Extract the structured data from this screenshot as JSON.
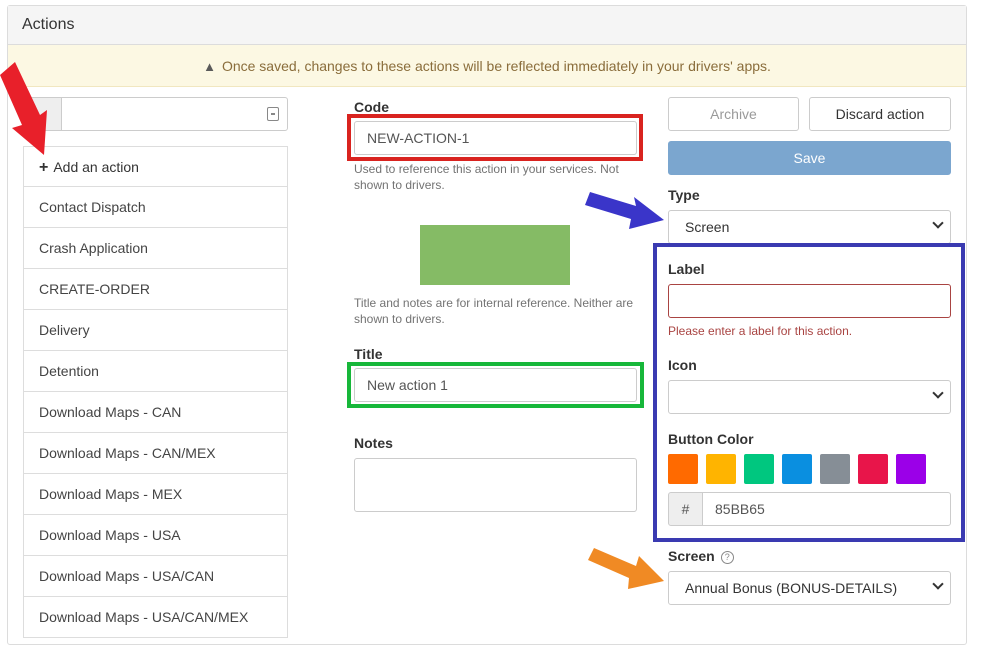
{
  "header": {
    "title": "Actions"
  },
  "warning": {
    "text": "Once saved, changes to these actions will be reflected immediately in your drivers' apps."
  },
  "search": {
    "placeholder": ""
  },
  "action_list": [
    "Add an action",
    "Contact Dispatch",
    "Crash Application",
    "CREATE-ORDER",
    "Delivery",
    "Detention",
    "Download Maps - CAN",
    "Download Maps - CAN/MEX",
    "Download Maps - MEX",
    "Download Maps - USA",
    "Download Maps - USA/CAN",
    "Download Maps - USA/CAN/MEX"
  ],
  "form": {
    "code_label": "Code",
    "code_value": "NEW-ACTION-1",
    "code_help": "Used to reference this action in your services. Not shown to drivers.",
    "preview_color": "#85BB65",
    "internal_help": "Title and notes are for internal reference. Neither are shown to drivers.",
    "title_label": "Title",
    "title_value": "New action 1",
    "notes_label": "Notes",
    "notes_value": ""
  },
  "buttons": {
    "archive": "Archive",
    "discard": "Discard action",
    "save": "Save"
  },
  "settings": {
    "type_label": "Type",
    "type_value": "Screen",
    "label_label": "Label",
    "label_value": "",
    "label_error": "Please enter a label for this action.",
    "icon_label": "Icon",
    "icon_value": "",
    "button_color_label": "Button Color",
    "swatches": [
      "#ff6a00",
      "#ffb400",
      "#00c77f",
      "#0a8fe0",
      "#868e96",
      "#e8154a",
      "#9b00e8"
    ],
    "hex_prefix": "#",
    "hex_value": "85BB65",
    "screen_label": "Screen",
    "screen_help_icon": "?",
    "screen_value": "Annual Bonus (BONUS-DETAILS)"
  },
  "annotation_colors": {
    "red": "#d9231f",
    "green": "#17b73a",
    "blue": "#3a3ab1",
    "orange": "#f08a24"
  }
}
